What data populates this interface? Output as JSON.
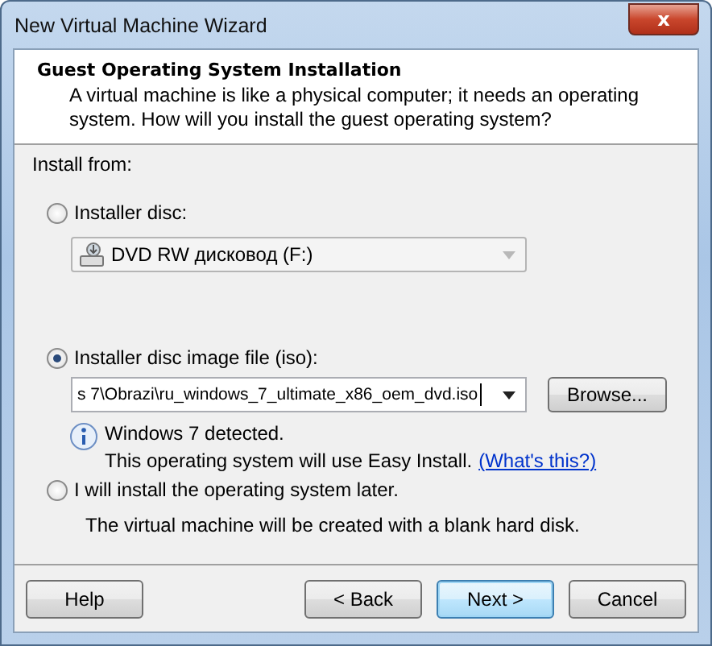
{
  "window": {
    "title": "New Virtual Machine Wizard",
    "close": "x"
  },
  "header": {
    "title": "Guest Operating System Installation",
    "description": "A virtual machine is like a physical computer; it needs an operating system. How will you install the guest operating system?"
  },
  "install_from": {
    "label": "Install from:"
  },
  "options": [
    {
      "kind": "disc",
      "label": "Installer disc:",
      "selected": false,
      "combo": {
        "value": "DVD RW дисковод (F:)",
        "disabled": true
      }
    },
    {
      "kind": "iso",
      "label": "Installer disc image file (iso):",
      "selected": true,
      "field": {
        "value": "s 7\\Obrazi\\ru_windows_7_ultimate_x86_oem_dvd.iso"
      },
      "browse": "Browse...",
      "info": {
        "detected": "Windows 7 detected.",
        "message": "This operating system will use Easy Install.",
        "link": "(What's this?)"
      }
    },
    {
      "kind": "later",
      "label": "I will install the operating system later.",
      "selected": false,
      "note": "The virtual machine will be created with a blank hard disk."
    }
  ],
  "buttons": [
    {
      "label": "Help",
      "kind": "help",
      "default": false
    },
    {
      "label": "< Back",
      "kind": "nav",
      "default": false
    },
    {
      "label": "Next >",
      "kind": "nav",
      "default": true
    },
    {
      "label": "Cancel",
      "kind": "nav",
      "default": false
    }
  ]
}
